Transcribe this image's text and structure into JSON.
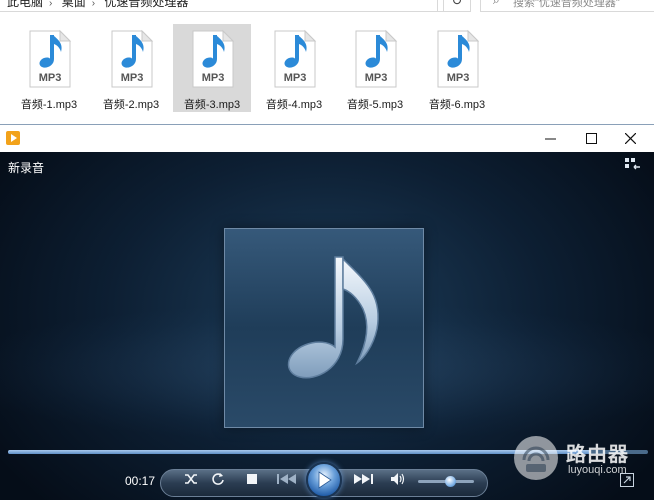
{
  "explorer": {
    "breadcrumbs": [
      "此电脑",
      "桌面",
      "优速音频处理器"
    ],
    "search_placeholder": "搜索\"优速音频处理器\"",
    "files": [
      {
        "name": "音频-1.mp3",
        "selected": false
      },
      {
        "name": "音频-2.mp3",
        "selected": false
      },
      {
        "name": "音频-3.mp3",
        "selected": true
      },
      {
        "name": "音频-4.mp3",
        "selected": false
      },
      {
        "name": "音频-5.mp3",
        "selected": false
      },
      {
        "name": "音频-6.mp3",
        "selected": false
      }
    ],
    "file_badge": "MP3"
  },
  "player": {
    "now_playing_title": "新录音",
    "time_elapsed": "00:17",
    "seek_progress_percent": 91,
    "volume_percent": 60,
    "accent_color": "#2f6fc0",
    "icons": [
      "shuffle-icon",
      "repeat-icon",
      "stop-icon",
      "previous-icon",
      "play-icon",
      "next-icon",
      "volume-icon"
    ]
  },
  "watermark": {
    "main": "路由器",
    "sub": "luyouqi.com"
  }
}
